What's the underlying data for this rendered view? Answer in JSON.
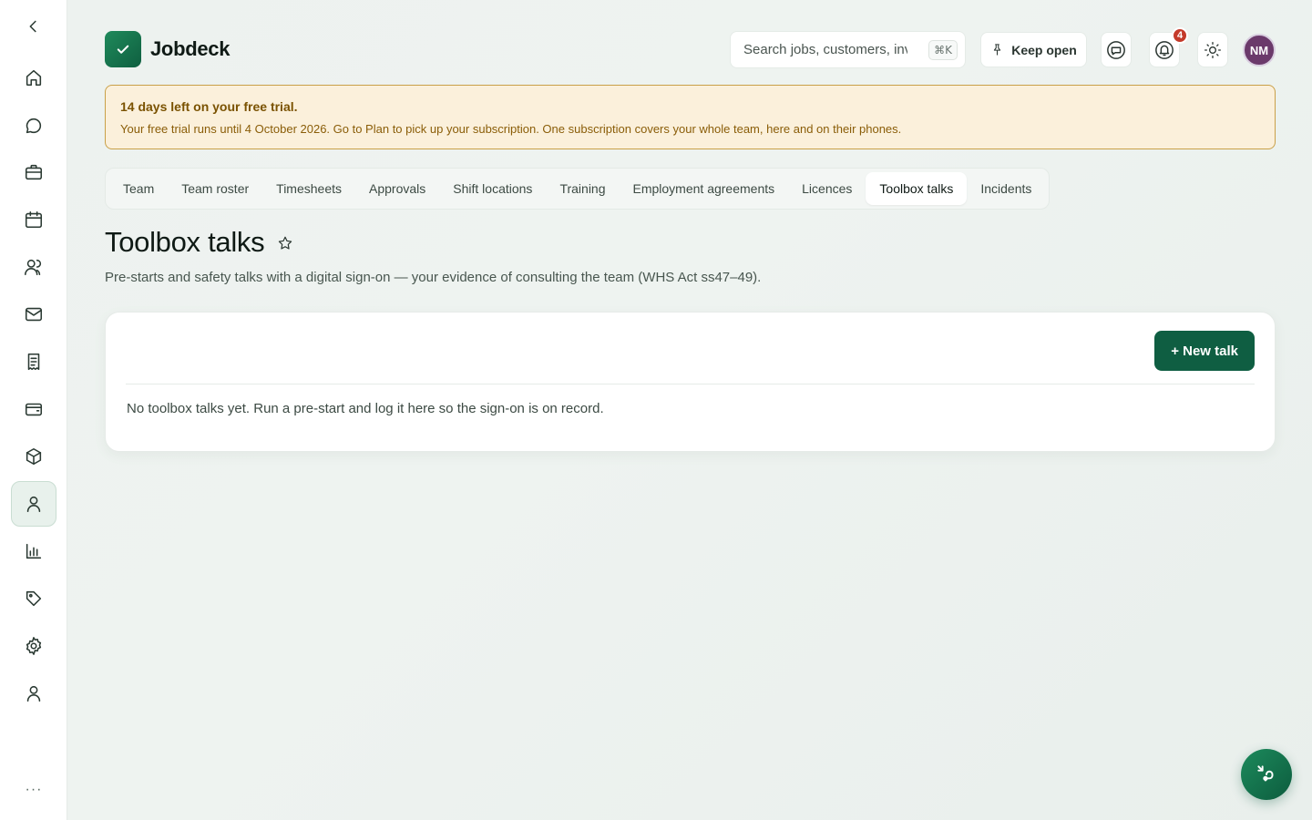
{
  "app": {
    "name": "Jobdeck"
  },
  "sidebar": {
    "items": [
      {
        "name": "home-icon"
      },
      {
        "name": "chat-icon"
      },
      {
        "name": "briefcase-icon"
      },
      {
        "name": "calendar-icon"
      },
      {
        "name": "team-icon"
      },
      {
        "name": "mail-icon"
      },
      {
        "name": "receipt-icon"
      },
      {
        "name": "wallet-icon"
      },
      {
        "name": "box-icon"
      },
      {
        "name": "person-icon",
        "active": true
      },
      {
        "name": "chart-icon"
      },
      {
        "name": "tag-icon"
      },
      {
        "name": "gear-icon"
      },
      {
        "name": "user-icon"
      }
    ],
    "more_label": "···"
  },
  "header": {
    "search_placeholder": "Search jobs, customers, invoices",
    "search_shortcut": "⌘K",
    "keep_open_label": "Keep open",
    "notification_count": "4",
    "avatar_initials": "NM"
  },
  "banner": {
    "title": "14 days left on your free trial.",
    "body": "Your free trial runs until 4 October 2026. Go to Plan to pick up your subscription. One subscription covers your whole team, here and on their phones."
  },
  "tabs": [
    {
      "label": "Team"
    },
    {
      "label": "Team roster"
    },
    {
      "label": "Timesheets"
    },
    {
      "label": "Approvals"
    },
    {
      "label": "Shift locations"
    },
    {
      "label": "Training"
    },
    {
      "label": "Employment agreements"
    },
    {
      "label": "Licences"
    },
    {
      "label": "Toolbox talks",
      "active": true
    },
    {
      "label": "Incidents"
    }
  ],
  "page": {
    "title": "Toolbox talks",
    "subtitle": "Pre-starts and safety talks with a digital sign-on — your evidence of consulting the team (WHS Act ss47–49).",
    "new_button_label": "+ New talk",
    "empty_message": "No toolbox talks yet. Run a pre-start and log it here so the sign-on is on record."
  },
  "colors": {
    "accent": "#0f5e42",
    "banner_bg": "#fbf0db",
    "banner_border": "#c9a048",
    "badge": "#c43a2a",
    "avatar": "#6b3a6b"
  }
}
